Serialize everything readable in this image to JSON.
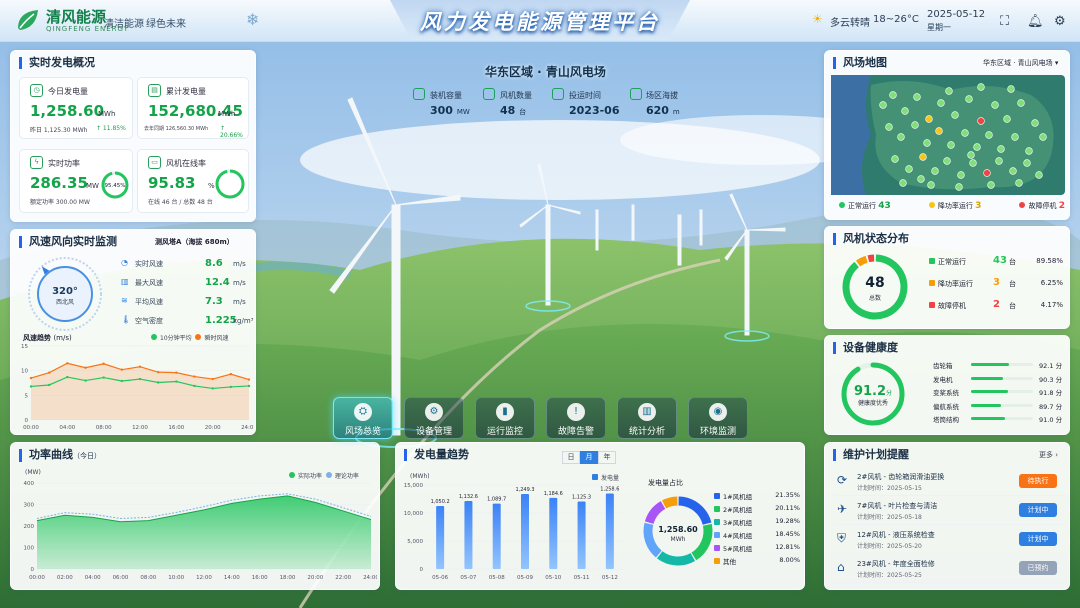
{
  "header": {
    "brand": "清风能源",
    "brand_en": "QINGFENG ENERGY",
    "slogan1": "清洁能源",
    "slogan2": "绿色未来",
    "title": "风力发电能源管理平台",
    "weather": "多云转晴",
    "temp": "18~26°C",
    "date": "2025-05-12",
    "weekday": "星期一"
  },
  "farm": {
    "name": "华东区域 · 青山风电场",
    "stats": [
      {
        "label": "装机容量",
        "value": "300",
        "unit": "MW"
      },
      {
        "label": "风机数量",
        "value": "48",
        "unit": "台"
      },
      {
        "label": "投运时间",
        "value": "2023-06",
        "unit": ""
      },
      {
        "label": "场区海拔",
        "value": "620",
        "unit": "m"
      }
    ]
  },
  "overview": {
    "title": "实时发电概况",
    "daily": {
      "label": "今日发电量",
      "value": "1,258.60",
      "unit": "MWh",
      "sub": "昨日 1,125.30 MWh",
      "trend": "↑ 11.85%"
    },
    "total": {
      "label": "累计发电量",
      "value": "152,680.45",
      "unit": "MWh",
      "sub": "去年同期 126,560.30 MWh",
      "trend": "↑ 20.66%"
    },
    "power": {
      "label": "实时功率",
      "value": "286.35",
      "unit": "MW",
      "sub": "额定功率 300.00 MW",
      "ring": "95.45%",
      "ring_value": 0.9545
    },
    "online": {
      "label": "风机在线率",
      "value": "95.83",
      "unit": "%",
      "sub": "在线 46 台 / 总数 48 台",
      "ring_value": 0.9583
    }
  },
  "wind": {
    "title": "风速风向实时监测",
    "station": "测风塔A（海拔 680m）",
    "compass_deg": "320°",
    "compass_dir": "西北风",
    "rows": [
      {
        "label": "实时风速",
        "value": "8.6",
        "unit": "m/s"
      },
      {
        "label": "最大风速",
        "value": "12.4",
        "unit": "m/s"
      },
      {
        "label": "平均风速",
        "value": "7.3",
        "unit": "m/s"
      },
      {
        "label": "空气密度",
        "value": "1.225",
        "unit": "kg/m³"
      }
    ],
    "trend_title": "风速趋势",
    "trend_unit": "(m/s)",
    "legend1": "10分钟平均",
    "legend2": "瞬时风速",
    "yticks": [
      "15",
      "10",
      "5",
      "0"
    ],
    "xticks": [
      "00:00",
      "04:00",
      "08:00",
      "12:00",
      "16:00",
      "20:00",
      "24:00"
    ]
  },
  "power_curve": {
    "title": "功率曲线",
    "sub": "（今日）",
    "unit": "(MW)",
    "legend1": "实际功率",
    "legend2": "理论功率",
    "yticks": [
      "400",
      "300",
      "200",
      "100",
      "0"
    ],
    "xticks": [
      "00:00",
      "02:00",
      "04:00",
      "06:00",
      "08:00",
      "10:00",
      "12:00",
      "14:00",
      "16:00",
      "18:00",
      "20:00",
      "22:00",
      "24:00"
    ]
  },
  "gen": {
    "title": "发电量趋势",
    "tabs": [
      "日",
      "月",
      "年"
    ],
    "unit": "(MWh)",
    "legend": "发电量",
    "yticks": [
      "15,000",
      "10,000",
      "5,000",
      "0"
    ],
    "pie_title": "发电量占比",
    "pie_value": "1,258.60",
    "pie_unit": "MWh",
    "pie_items": [
      {
        "name": "1#风机组",
        "pct": "21.35%",
        "color": "#2563eb",
        "v": 21.35
      },
      {
        "name": "2#风机组",
        "pct": "20.11%",
        "color": "#22c55e",
        "v": 20.11
      },
      {
        "name": "3#风机组",
        "pct": "19.28%",
        "color": "#14b8a6",
        "v": 19.28
      },
      {
        "name": "4#风机组",
        "pct": "18.45%",
        "color": "#60a5fa",
        "v": 18.45
      },
      {
        "name": "5#风机组",
        "pct": "12.81%",
        "color": "#a855f7",
        "v": 12.81
      },
      {
        "name": "其他",
        "pct": "8.00%",
        "color": "#f59e0b",
        "v": 8.0
      }
    ]
  },
  "map": {
    "title": "风场地图",
    "select": "华东区域 · 青山风电场",
    "legend": [
      {
        "label": "正常运行",
        "count": "43",
        "color": "#22c55e"
      },
      {
        "label": "降功率运行",
        "count": "3",
        "color": "#f5c518"
      },
      {
        "label": "故障停机",
        "count": "2",
        "color": "#ef4444"
      }
    ]
  },
  "status": {
    "title": "风机状态分布",
    "total": "48",
    "total_label": "总数",
    "rows": [
      {
        "label": "正常运行",
        "count": "43",
        "unit": "台",
        "pct": "89.58%",
        "color": "#22c55e",
        "v": 43
      },
      {
        "label": "降功率运行",
        "count": "3",
        "unit": "台",
        "pct": "6.25%",
        "color": "#f59e0b",
        "v": 3
      },
      {
        "label": "故障停机",
        "count": "2",
        "unit": "台",
        "pct": "4.17%",
        "color": "#ef4444",
        "v": 2
      }
    ]
  },
  "health": {
    "title": "设备健康度",
    "score": "91.2",
    "score_unit": "分",
    "score_label": "健康度优秀",
    "score_value": 0.912,
    "rows": [
      {
        "label": "齿轮箱",
        "value": "92.1",
        "unit": "分",
        "v": 92.1
      },
      {
        "label": "发电机",
        "value": "90.3",
        "unit": "分",
        "v": 90.3
      },
      {
        "label": "变桨系统",
        "value": "91.8",
        "unit": "分",
        "v": 91.8
      },
      {
        "label": "偏航系统",
        "value": "89.7",
        "unit": "分",
        "v": 89.7
      },
      {
        "label": "塔筒结构",
        "value": "91.0",
        "unit": "分",
        "v": 91.0
      }
    ]
  },
  "maint": {
    "title": "维护计划提醒",
    "more": "更多 ›",
    "items": [
      {
        "title": "2#风机 - 齿轮箱润滑油更换",
        "time": "计划时间：2025-05-15",
        "status": "待执行",
        "color": "#f97316"
      },
      {
        "title": "7#风机 - 叶片检查与清洁",
        "time": "计划时间：2025-05-18",
        "status": "计划中",
        "color": "#2f7fe0"
      },
      {
        "title": "12#风机 - 液压系统检查",
        "time": "计划时间：2025-05-20",
        "status": "计划中",
        "color": "#2f7fe0"
      },
      {
        "title": "23#风机 - 年度全面检修",
        "time": "计划时间：2025-05-25",
        "status": "已预约",
        "color": "#94a3b8"
      }
    ]
  },
  "nav": [
    {
      "label": "风场总览",
      "icon": "⛭"
    },
    {
      "label": "设备管理",
      "icon": "⚙"
    },
    {
      "label": "运行监控",
      "icon": "▮"
    },
    {
      "label": "故障告警",
      "icon": "!"
    },
    {
      "label": "统计分析",
      "icon": "▥"
    },
    {
      "label": "环境监测",
      "icon": "◉"
    }
  ],
  "chart_data": [
    {
      "type": "line",
      "title": "风速趋势",
      "ylabel": "(m/s)",
      "ylim": [
        0,
        15
      ],
      "x": [
        "00:00",
        "02:00",
        "04:00",
        "06:00",
        "08:00",
        "10:00",
        "12:00",
        "14:00",
        "16:00",
        "18:00",
        "20:00",
        "22:00",
        "24:00"
      ],
      "series": [
        {
          "name": "10分钟平均",
          "values": [
            6.8,
            7.1,
            8.7,
            8.0,
            8.6,
            7.9,
            8.3,
            7.6,
            7.8,
            6.9,
            6.4,
            6.7,
            6.9
          ]
        },
        {
          "name": "瞬时风速",
          "values": [
            8.5,
            9.6,
            11.5,
            10.6,
            11.4,
            10.2,
            10.8,
            9.7,
            9.6,
            8.8,
            8.3,
            9.3,
            8.2
          ]
        }
      ]
    },
    {
      "type": "area",
      "title": "功率曲线",
      "ylabel": "(MW)",
      "ylim": [
        0,
        400
      ],
      "x": [
        "00:00",
        "02:00",
        "04:00",
        "06:00",
        "08:00",
        "10:00",
        "12:00",
        "14:00",
        "16:00",
        "18:00",
        "20:00",
        "22:00",
        "24:00"
      ],
      "series": [
        {
          "name": "实际功率",
          "values": [
            225,
            250,
            240,
            220,
            225,
            250,
            275,
            305,
            325,
            340,
            310,
            270,
            230
          ]
        },
        {
          "name": "理论功率",
          "values": [
            235,
            262,
            255,
            235,
            240,
            263,
            290,
            320,
            340,
            350,
            325,
            285,
            245
          ]
        }
      ]
    },
    {
      "type": "bar",
      "title": "发电量趋势",
      "ylabel": "(MWh)",
      "ylim": [
        0,
        15000
      ],
      "categories": [
        "05-06",
        "05-07",
        "05-08",
        "05-09",
        "05-10",
        "05-11",
        "05-12"
      ],
      "series": [
        {
          "name": "发电量",
          "values": [
            1050.2,
            1132.6,
            1089.7,
            1249.3,
            1184.6,
            1125.3,
            1258.6
          ]
        }
      ],
      "labels": [
        "1,050.2",
        "1,132.6",
        "1,089.7",
        "1,249.3",
        "1,184.6",
        "1,125.3",
        "1,258.6"
      ]
    }
  ]
}
